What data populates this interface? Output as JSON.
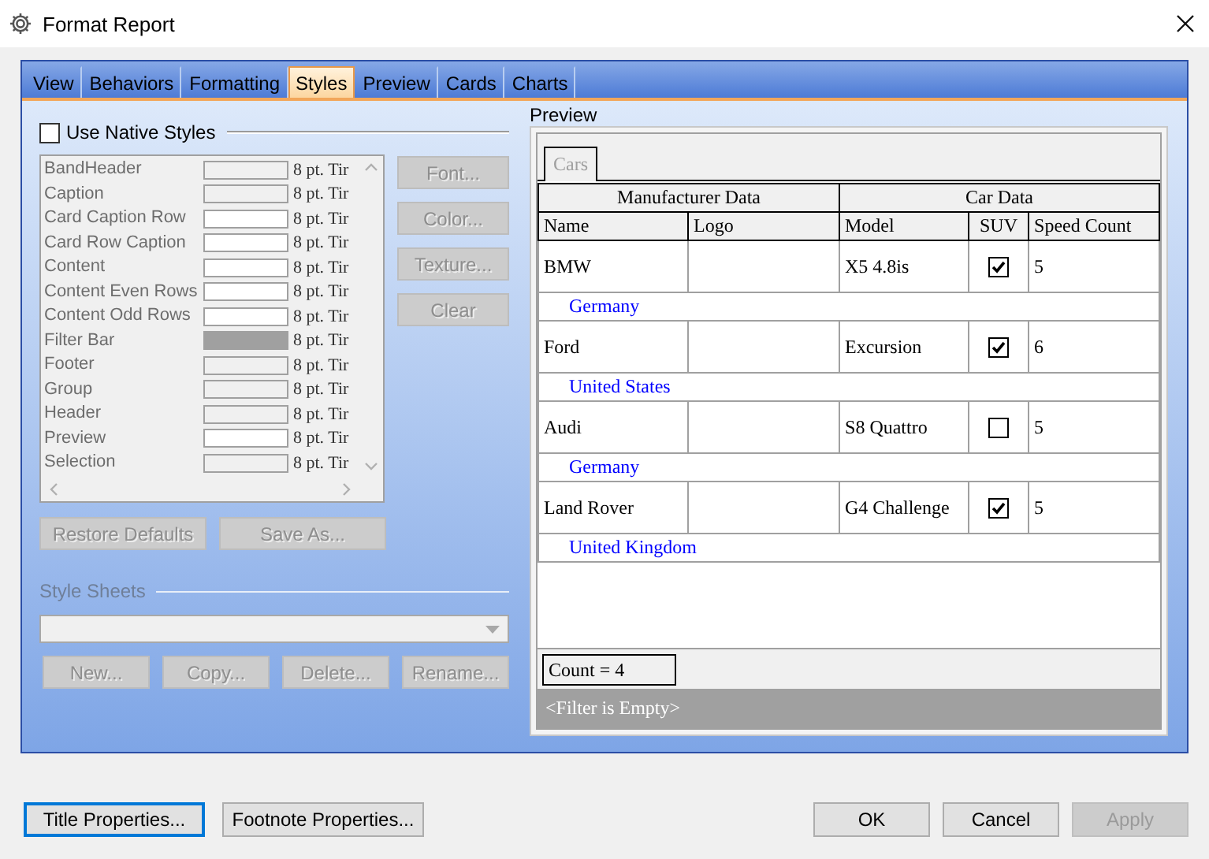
{
  "window": {
    "title": "Format Report"
  },
  "tabs": [
    {
      "label": "View",
      "selected": false
    },
    {
      "label": "Behaviors",
      "selected": false
    },
    {
      "label": "Formatting",
      "selected": false
    },
    {
      "label": "Styles",
      "selected": true
    },
    {
      "label": "Preview",
      "selected": false
    },
    {
      "label": "Cards",
      "selected": false
    },
    {
      "label": "Charts",
      "selected": false
    }
  ],
  "styles_panel": {
    "use_native_styles": {
      "label": "Use Native Styles",
      "checked": false
    },
    "style_list": {
      "disabled": true,
      "items": [
        {
          "name": "BandHeader",
          "color": "#f0f0f0",
          "font": "8 pt. Tir"
        },
        {
          "name": "Caption",
          "color": "#f0f0f0",
          "font": "8 pt. Tir"
        },
        {
          "name": "Card Caption Row",
          "color": "#ffffff",
          "font": "8 pt. Tir"
        },
        {
          "name": "Card Row Caption",
          "color": "#ffffff",
          "font": "8 pt. Tir"
        },
        {
          "name": "Content",
          "color": "#ffffff",
          "font": "8 pt. Tir"
        },
        {
          "name": "Content Even Rows",
          "color": "#ffffff",
          "font": "8 pt. Tir"
        },
        {
          "name": "Content Odd Rows",
          "color": "#ffffff",
          "font": "8 pt. Tir"
        },
        {
          "name": "Filter Bar",
          "color": "#a0a0a0",
          "font": "8 pt. Tir"
        },
        {
          "name": "Footer",
          "color": "#f0f0f0",
          "font": "8 pt. Tir"
        },
        {
          "name": "Group",
          "color": "#f0f0f0",
          "font": "8 pt. Tir"
        },
        {
          "name": "Header",
          "color": "#f0f0f0",
          "font": "8 pt. Tir"
        },
        {
          "name": "Preview",
          "color": "#ffffff",
          "font": "8 pt. Tir"
        },
        {
          "name": "Selection",
          "color": "#f0f0f0",
          "font": "8 pt. Tir"
        }
      ]
    },
    "style_buttons": [
      {
        "label": "Font...",
        "disabled": true
      },
      {
        "label": "Color...",
        "disabled": true
      },
      {
        "label": "Texture...",
        "disabled": true
      },
      {
        "label": "Clear",
        "disabled": true
      }
    ],
    "list_buttons": [
      {
        "label": "Restore Defaults",
        "disabled": true
      },
      {
        "label": "Save As...",
        "disabled": true
      }
    ],
    "style_sheets": {
      "label": "Style Sheets",
      "disabled": true,
      "buttons": [
        {
          "label": "New...",
          "disabled": true
        },
        {
          "label": "Copy...",
          "disabled": true
        },
        {
          "label": "Delete...",
          "disabled": true
        },
        {
          "label": "Rename...",
          "disabled": true
        }
      ]
    }
  },
  "preview": {
    "label": "Preview",
    "tab": "Cars",
    "band_headers": [
      "Manufacturer Data",
      "Car Data"
    ],
    "columns": [
      "Name",
      "Logo",
      "Model",
      "SUV",
      "Speed Count"
    ],
    "rows": [
      {
        "name": "BMW",
        "model": "X5 4.8is",
        "suv": true,
        "speed_count": "5",
        "group": "Germany"
      },
      {
        "name": "Ford",
        "model": "Excursion",
        "suv": true,
        "speed_count": "6",
        "group": "United States"
      },
      {
        "name": "Audi",
        "model": "S8 Quattro",
        "suv": false,
        "speed_count": "5",
        "group": "Germany"
      },
      {
        "name": "Land Rover",
        "model": "G4 Challenge",
        "suv": true,
        "speed_count": "5",
        "group": "United Kingdom"
      }
    ],
    "count": "Count = 4",
    "filter": "<Filter is Empty>"
  },
  "footer_buttons": [
    {
      "label": "Title Properties...",
      "focused": true,
      "disabled": false
    },
    {
      "label": "Footnote Properties...",
      "focused": false,
      "disabled": false
    },
    {
      "label": "OK",
      "focused": false,
      "disabled": false
    },
    {
      "label": "Cancel",
      "focused": false,
      "disabled": false
    },
    {
      "label": "Apply",
      "focused": false,
      "disabled": true
    }
  ]
}
